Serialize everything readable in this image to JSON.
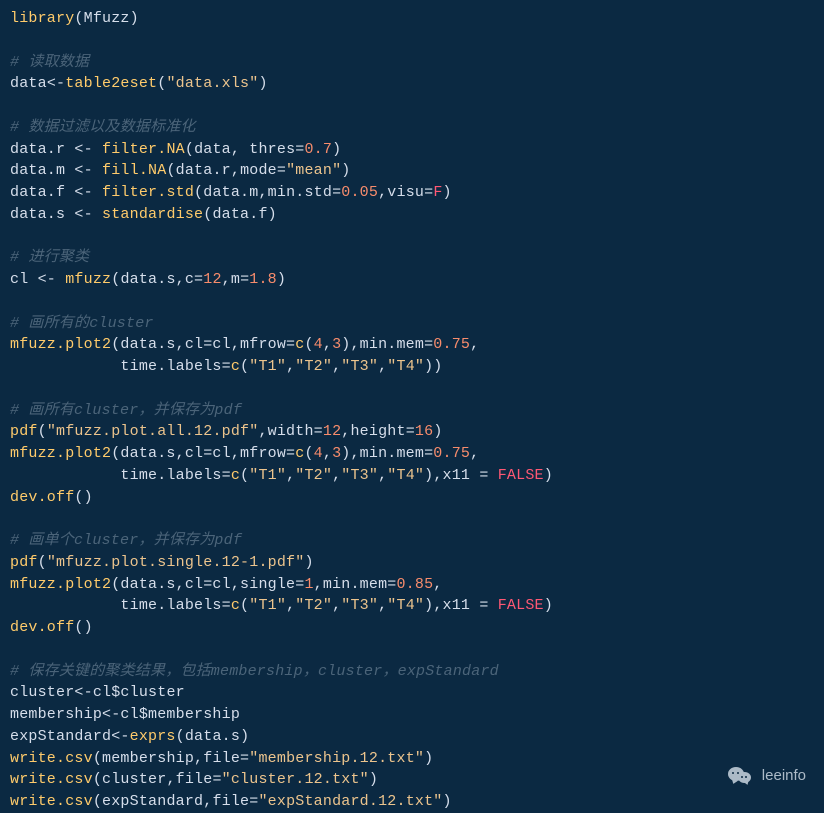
{
  "code": {
    "lines": [
      {
        "segments": [
          {
            "cls": "fn",
            "t": "library"
          },
          {
            "cls": "paren",
            "t": "("
          },
          {
            "cls": "def",
            "t": "Mfuzz"
          },
          {
            "cls": "paren",
            "t": ")"
          }
        ]
      },
      {
        "segments": []
      },
      {
        "segments": [
          {
            "cls": "cmt",
            "t": "# 读取数据"
          }
        ]
      },
      {
        "segments": [
          {
            "cls": "def",
            "t": "data"
          },
          {
            "cls": "arrow",
            "t": "<-"
          },
          {
            "cls": "fn",
            "t": "table2eset"
          },
          {
            "cls": "paren",
            "t": "("
          },
          {
            "cls": "str",
            "t": "\"data.xls\""
          },
          {
            "cls": "paren",
            "t": ")"
          }
        ]
      },
      {
        "segments": []
      },
      {
        "segments": [
          {
            "cls": "cmt",
            "t": "# 数据过滤以及数据标准化"
          }
        ]
      },
      {
        "segments": [
          {
            "cls": "def",
            "t": "data.r "
          },
          {
            "cls": "arrow",
            "t": "<-"
          },
          {
            "cls": "def",
            "t": " "
          },
          {
            "cls": "fn",
            "t": "filter.NA"
          },
          {
            "cls": "paren",
            "t": "("
          },
          {
            "cls": "def",
            "t": "data, thres="
          },
          {
            "cls": "num",
            "t": "0.7"
          },
          {
            "cls": "paren",
            "t": ")"
          }
        ]
      },
      {
        "segments": [
          {
            "cls": "def",
            "t": "data.m "
          },
          {
            "cls": "arrow",
            "t": "<-"
          },
          {
            "cls": "def",
            "t": " "
          },
          {
            "cls": "fn",
            "t": "fill.NA"
          },
          {
            "cls": "paren",
            "t": "("
          },
          {
            "cls": "def",
            "t": "data.r,mode="
          },
          {
            "cls": "str",
            "t": "\"mean\""
          },
          {
            "cls": "paren",
            "t": ")"
          }
        ]
      },
      {
        "segments": [
          {
            "cls": "def",
            "t": "data.f "
          },
          {
            "cls": "arrow",
            "t": "<-"
          },
          {
            "cls": "def",
            "t": " "
          },
          {
            "cls": "fn",
            "t": "filter.std"
          },
          {
            "cls": "paren",
            "t": "("
          },
          {
            "cls": "def",
            "t": "data.m,min.std="
          },
          {
            "cls": "num",
            "t": "0.05"
          },
          {
            "cls": "def",
            "t": ",visu="
          },
          {
            "cls": "kw",
            "t": "F"
          },
          {
            "cls": "paren",
            "t": ")"
          }
        ]
      },
      {
        "segments": [
          {
            "cls": "def",
            "t": "data.s "
          },
          {
            "cls": "arrow",
            "t": "<-"
          },
          {
            "cls": "def",
            "t": " "
          },
          {
            "cls": "fn",
            "t": "standardise"
          },
          {
            "cls": "paren",
            "t": "("
          },
          {
            "cls": "def",
            "t": "data.f"
          },
          {
            "cls": "paren",
            "t": ")"
          }
        ]
      },
      {
        "segments": []
      },
      {
        "segments": [
          {
            "cls": "cmt",
            "t": "# 进行聚类"
          }
        ]
      },
      {
        "segments": [
          {
            "cls": "def",
            "t": "cl "
          },
          {
            "cls": "arrow",
            "t": "<-"
          },
          {
            "cls": "def",
            "t": " "
          },
          {
            "cls": "fn",
            "t": "mfuzz"
          },
          {
            "cls": "paren",
            "t": "("
          },
          {
            "cls": "def",
            "t": "data.s,c="
          },
          {
            "cls": "num",
            "t": "12"
          },
          {
            "cls": "def",
            "t": ",m="
          },
          {
            "cls": "num",
            "t": "1.8"
          },
          {
            "cls": "paren",
            "t": ")"
          }
        ]
      },
      {
        "segments": []
      },
      {
        "segments": [
          {
            "cls": "cmt",
            "t": "# 画所有的cluster"
          }
        ]
      },
      {
        "segments": [
          {
            "cls": "fn",
            "t": "mfuzz.plot2"
          },
          {
            "cls": "paren",
            "t": "("
          },
          {
            "cls": "def",
            "t": "data.s,cl=cl,mfrow="
          },
          {
            "cls": "fn",
            "t": "c"
          },
          {
            "cls": "paren",
            "t": "("
          },
          {
            "cls": "num",
            "t": "4"
          },
          {
            "cls": "def",
            "t": ","
          },
          {
            "cls": "num",
            "t": "3"
          },
          {
            "cls": "paren",
            "t": ")"
          },
          {
            "cls": "def",
            "t": ",min.mem="
          },
          {
            "cls": "num",
            "t": "0.75"
          },
          {
            "cls": "def",
            "t": ","
          }
        ]
      },
      {
        "segments": [
          {
            "cls": "def",
            "t": "            time.labels="
          },
          {
            "cls": "fn",
            "t": "c"
          },
          {
            "cls": "paren",
            "t": "("
          },
          {
            "cls": "str",
            "t": "\"T1\""
          },
          {
            "cls": "def",
            "t": ","
          },
          {
            "cls": "str",
            "t": "\"T2\""
          },
          {
            "cls": "def",
            "t": ","
          },
          {
            "cls": "str",
            "t": "\"T3\""
          },
          {
            "cls": "def",
            "t": ","
          },
          {
            "cls": "str",
            "t": "\"T4\""
          },
          {
            "cls": "paren",
            "t": "))"
          }
        ]
      },
      {
        "segments": []
      },
      {
        "segments": [
          {
            "cls": "cmt",
            "t": "# 画所有cluster，并保存为pdf"
          }
        ]
      },
      {
        "segments": [
          {
            "cls": "fn",
            "t": "pdf"
          },
          {
            "cls": "paren",
            "t": "("
          },
          {
            "cls": "str",
            "t": "\"mfuzz.plot.all.12.pdf\""
          },
          {
            "cls": "def",
            "t": ",width="
          },
          {
            "cls": "num",
            "t": "12"
          },
          {
            "cls": "def",
            "t": ",height="
          },
          {
            "cls": "num",
            "t": "16"
          },
          {
            "cls": "paren",
            "t": ")"
          }
        ]
      },
      {
        "segments": [
          {
            "cls": "fn",
            "t": "mfuzz.plot2"
          },
          {
            "cls": "paren",
            "t": "("
          },
          {
            "cls": "def",
            "t": "data.s,cl=cl,mfrow="
          },
          {
            "cls": "fn",
            "t": "c"
          },
          {
            "cls": "paren",
            "t": "("
          },
          {
            "cls": "num",
            "t": "4"
          },
          {
            "cls": "def",
            "t": ","
          },
          {
            "cls": "num",
            "t": "3"
          },
          {
            "cls": "paren",
            "t": ")"
          },
          {
            "cls": "def",
            "t": ",min.mem="
          },
          {
            "cls": "num",
            "t": "0.75"
          },
          {
            "cls": "def",
            "t": ","
          }
        ]
      },
      {
        "segments": [
          {
            "cls": "def",
            "t": "            time.labels="
          },
          {
            "cls": "fn",
            "t": "c"
          },
          {
            "cls": "paren",
            "t": "("
          },
          {
            "cls": "str",
            "t": "\"T1\""
          },
          {
            "cls": "def",
            "t": ","
          },
          {
            "cls": "str",
            "t": "\"T2\""
          },
          {
            "cls": "def",
            "t": ","
          },
          {
            "cls": "str",
            "t": "\"T3\""
          },
          {
            "cls": "def",
            "t": ","
          },
          {
            "cls": "str",
            "t": "\"T4\""
          },
          {
            "cls": "paren",
            "t": ")"
          },
          {
            "cls": "def",
            "t": ",x11 = "
          },
          {
            "cls": "kw",
            "t": "FALSE"
          },
          {
            "cls": "paren",
            "t": ")"
          }
        ]
      },
      {
        "segments": [
          {
            "cls": "fn",
            "t": "dev.off"
          },
          {
            "cls": "paren",
            "t": "()"
          }
        ]
      },
      {
        "segments": []
      },
      {
        "segments": [
          {
            "cls": "cmt",
            "t": "# 画单个cluster，并保存为pdf"
          }
        ]
      },
      {
        "segments": [
          {
            "cls": "fn",
            "t": "pdf"
          },
          {
            "cls": "paren",
            "t": "("
          },
          {
            "cls": "str",
            "t": "\"mfuzz.plot.single.12-1.pdf\""
          },
          {
            "cls": "paren",
            "t": ")"
          }
        ]
      },
      {
        "segments": [
          {
            "cls": "fn",
            "t": "mfuzz.plot2"
          },
          {
            "cls": "paren",
            "t": "("
          },
          {
            "cls": "def",
            "t": "data.s,cl=cl,single="
          },
          {
            "cls": "num",
            "t": "1"
          },
          {
            "cls": "def",
            "t": ",min.mem="
          },
          {
            "cls": "num",
            "t": "0.85"
          },
          {
            "cls": "def",
            "t": ","
          }
        ]
      },
      {
        "segments": [
          {
            "cls": "def",
            "t": "            time.labels="
          },
          {
            "cls": "fn",
            "t": "c"
          },
          {
            "cls": "paren",
            "t": "("
          },
          {
            "cls": "str",
            "t": "\"T1\""
          },
          {
            "cls": "def",
            "t": ","
          },
          {
            "cls": "str",
            "t": "\"T2\""
          },
          {
            "cls": "def",
            "t": ","
          },
          {
            "cls": "str",
            "t": "\"T3\""
          },
          {
            "cls": "def",
            "t": ","
          },
          {
            "cls": "str",
            "t": "\"T4\""
          },
          {
            "cls": "paren",
            "t": ")"
          },
          {
            "cls": "def",
            "t": ",x11 = "
          },
          {
            "cls": "kw",
            "t": "FALSE"
          },
          {
            "cls": "paren",
            "t": ")"
          }
        ]
      },
      {
        "segments": [
          {
            "cls": "fn",
            "t": "dev.off"
          },
          {
            "cls": "paren",
            "t": "()"
          }
        ]
      },
      {
        "segments": []
      },
      {
        "segments": [
          {
            "cls": "cmt",
            "t": "# 保存关键的聚类结果，包括membership，cluster，expStandard"
          }
        ]
      },
      {
        "segments": [
          {
            "cls": "def",
            "t": "cluster"
          },
          {
            "cls": "arrow",
            "t": "<-"
          },
          {
            "cls": "def",
            "t": "cl$cluster"
          }
        ]
      },
      {
        "segments": [
          {
            "cls": "def",
            "t": "membership"
          },
          {
            "cls": "arrow",
            "t": "<-"
          },
          {
            "cls": "def",
            "t": "cl$membership"
          }
        ]
      },
      {
        "segments": [
          {
            "cls": "def",
            "t": "expStandard"
          },
          {
            "cls": "arrow",
            "t": "<-"
          },
          {
            "cls": "fn",
            "t": "exprs"
          },
          {
            "cls": "paren",
            "t": "("
          },
          {
            "cls": "def",
            "t": "data.s"
          },
          {
            "cls": "paren",
            "t": ")"
          }
        ]
      },
      {
        "segments": [
          {
            "cls": "fn",
            "t": "write.csv"
          },
          {
            "cls": "paren",
            "t": "("
          },
          {
            "cls": "def",
            "t": "membership,file="
          },
          {
            "cls": "str",
            "t": "\"membership.12.txt\""
          },
          {
            "cls": "paren",
            "t": ")"
          }
        ]
      },
      {
        "segments": [
          {
            "cls": "fn",
            "t": "write.csv"
          },
          {
            "cls": "paren",
            "t": "("
          },
          {
            "cls": "def",
            "t": "cluster,file="
          },
          {
            "cls": "str",
            "t": "\"cluster.12.txt\""
          },
          {
            "cls": "paren",
            "t": ")"
          }
        ]
      },
      {
        "segments": [
          {
            "cls": "fn",
            "t": "write.csv"
          },
          {
            "cls": "paren",
            "t": "("
          },
          {
            "cls": "def",
            "t": "expStandard,file="
          },
          {
            "cls": "str",
            "t": "\"expStandard.12.txt\""
          },
          {
            "cls": "paren",
            "t": ")"
          }
        ]
      }
    ]
  },
  "watermark": {
    "label": "leeinfo"
  }
}
